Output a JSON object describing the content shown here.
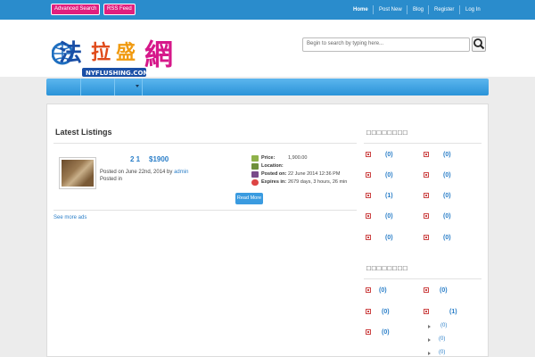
{
  "topbar": {
    "advanced_search": "Advanced Search",
    "rss_feed": "RSS Feed",
    "nav": [
      "Home",
      "Post New",
      "Blog",
      "Register",
      "Log In"
    ]
  },
  "header": {
    "logo_chars": "法拉盛網",
    "logo_domain": "NYFLUSHING.COM",
    "search_placeholder": "Begin to search by typing here..."
  },
  "main": {
    "latest_heading": "Latest Listings",
    "listing": {
      "title": "2 1",
      "price": "$1900",
      "posted_prefix": "Posted on June 22nd, 2014 by",
      "author": "admin",
      "posted_in": "Posted in",
      "details": [
        {
          "label": "Price:",
          "value": "1,900.00"
        },
        {
          "label": "Location:",
          "value": ""
        },
        {
          "label": "Posted on:",
          "value": "22 June 2014 12:36 PM"
        },
        {
          "label": "Expires in:",
          "value": "2679 days, 3 hours, 26 min"
        }
      ],
      "read_more": "Read More"
    },
    "see_more": "See more ads"
  },
  "sidebar": {
    "heading_1": "□□□□□□□□",
    "heading_2": "□□□□□□□□",
    "cats_1": [
      "(0)",
      "(0)",
      "(0)",
      "(0)",
      "(1)",
      "(0)",
      "(0)",
      "(0)",
      "(0)",
      "(0)"
    ],
    "cats_2": [
      "(0)",
      "(0)",
      "(0)",
      "(1)",
      "(0)"
    ],
    "subcats_2": [
      "(0)",
      "(0)",
      "(0)"
    ]
  },
  "colors": {
    "topbar": "#2a8ccc",
    "pill": "#e01f7e",
    "link": "#2a7ec8",
    "menubar": "#3aa2e2"
  }
}
